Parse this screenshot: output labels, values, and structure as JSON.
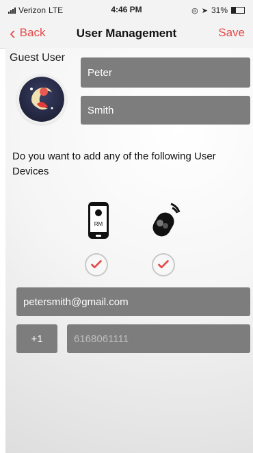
{
  "status": {
    "carrier": "Verizon",
    "network": "LTE",
    "time": "4:46 PM",
    "battery": "31%",
    "icons": [
      "signal-icon",
      "location-icon",
      "gps-icon",
      "battery-icon"
    ]
  },
  "nav": {
    "back_label": "Back",
    "title": "User Management",
    "save_label": "Save",
    "accent": "#e44a4a"
  },
  "user": {
    "section_label": "Guest User",
    "first_name": "Peter",
    "last_name": "Smith"
  },
  "devices": {
    "prompt": "Do you want to add any of the following User Devices",
    "items": [
      {
        "name": "phone-device-icon",
        "checked": true,
        "label": "RM"
      },
      {
        "name": "remote-fob-icon",
        "checked": true
      }
    ]
  },
  "contact": {
    "email": "petersmith@gmail.com",
    "country_code": "+1",
    "phone_placeholder": "6168061111"
  }
}
